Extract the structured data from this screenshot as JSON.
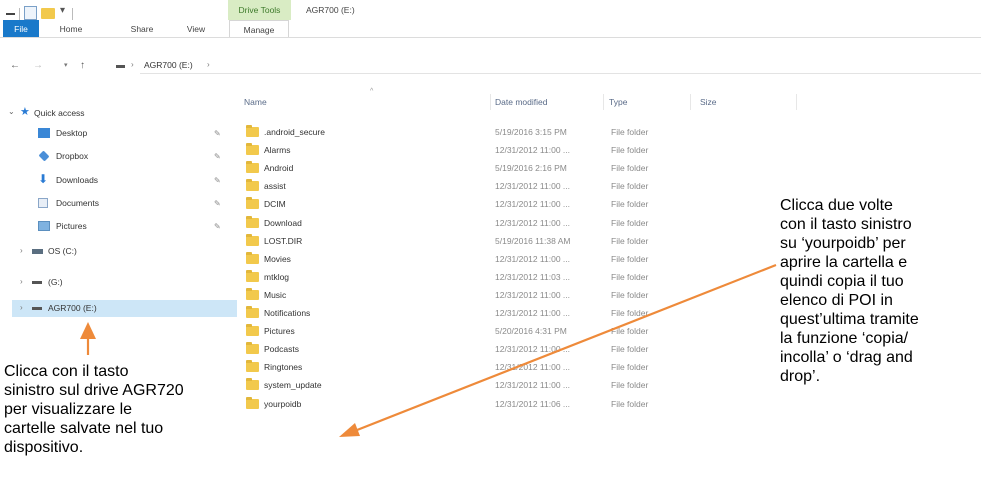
{
  "ribbon": {
    "drive_tools": "Drive Tools",
    "window_title": "AGR700 (E:)",
    "tabs": [
      {
        "label": "File"
      },
      {
        "label": "Home"
      },
      {
        "label": "Share"
      },
      {
        "label": "View"
      },
      {
        "label": "Manage"
      }
    ]
  },
  "address": {
    "path": "AGR700 (E:)",
    "separator": "›"
  },
  "nav_pane": {
    "quick_access": "Quick access",
    "items": [
      {
        "label": "Desktop",
        "icon": "desktop-icon"
      },
      {
        "label": "Dropbox",
        "icon": "dropbox-icon"
      },
      {
        "label": "Downloads",
        "icon": "downloads-icon"
      },
      {
        "label": "Documents",
        "icon": "documents-icon"
      },
      {
        "label": "Pictures",
        "icon": "pictures-icon"
      }
    ],
    "drives": [
      {
        "label": "OS (C:)",
        "icon": "os-drive-icon"
      },
      {
        "label": "(G:)",
        "icon": "drive-icon"
      },
      {
        "label": "AGR700 (E:)",
        "icon": "drive-icon",
        "selected": true
      }
    ]
  },
  "columns": {
    "name": "Name",
    "date_modified": "Date modified",
    "type": "Type",
    "size": "Size"
  },
  "files": [
    {
      "name": ".android_secure",
      "date": "5/19/2016 3:15 PM",
      "type": "File folder"
    },
    {
      "name": "Alarms",
      "date": "12/31/2012 11:00 ...",
      "type": "File folder"
    },
    {
      "name": "Android",
      "date": "5/19/2016 2:16 PM",
      "type": "File folder"
    },
    {
      "name": "assist",
      "date": "12/31/2012 11:00 ...",
      "type": "File folder"
    },
    {
      "name": "DCIM",
      "date": "12/31/2012 11:00 ...",
      "type": "File folder"
    },
    {
      "name": "Download",
      "date": "12/31/2012 11:00 ...",
      "type": "File folder"
    },
    {
      "name": "LOST.DIR",
      "date": "5/19/2016 11:38 AM",
      "type": "File folder"
    },
    {
      "name": "Movies",
      "date": "12/31/2012 11:00 ...",
      "type": "File folder"
    },
    {
      "name": "mtklog",
      "date": "12/31/2012 11:03 ...",
      "type": "File folder"
    },
    {
      "name": "Music",
      "date": "12/31/2012 11:00 ...",
      "type": "File folder"
    },
    {
      "name": "Notifications",
      "date": "12/31/2012 11:00 ...",
      "type": "File folder"
    },
    {
      "name": "Pictures",
      "date": "5/20/2016 4:31 PM",
      "type": "File folder"
    },
    {
      "name": "Podcasts",
      "date": "12/31/2012 11:00 ...",
      "type": "File folder"
    },
    {
      "name": "Ringtones",
      "date": "12/31/2012 11:00 ...",
      "type": "File folder"
    },
    {
      "name": "system_update",
      "date": "12/31/2012 11:00 ...",
      "type": "File folder"
    },
    {
      "name": "yourpoidb",
      "date": "12/31/2012 11:06 ...",
      "type": "File folder"
    }
  ],
  "annotations": {
    "left": "Clicca con il tasto\nsinistro sul drive AGR720\nper visualizzare le\ncartelle salvate nel tuo\ndispositivo.",
    "right": "Clicca due volte\ncon il tasto sinistro\nsu ‘yourpoidb’ per\naprire la cartella e\nquindi copia il tuo\nelenco di POI in\nquest’ultima tramite\nla funzione ‘copia/\nincolla’ o ‘drag and\ndrop’.",
    "arrow_color": "#ee8a3a"
  }
}
